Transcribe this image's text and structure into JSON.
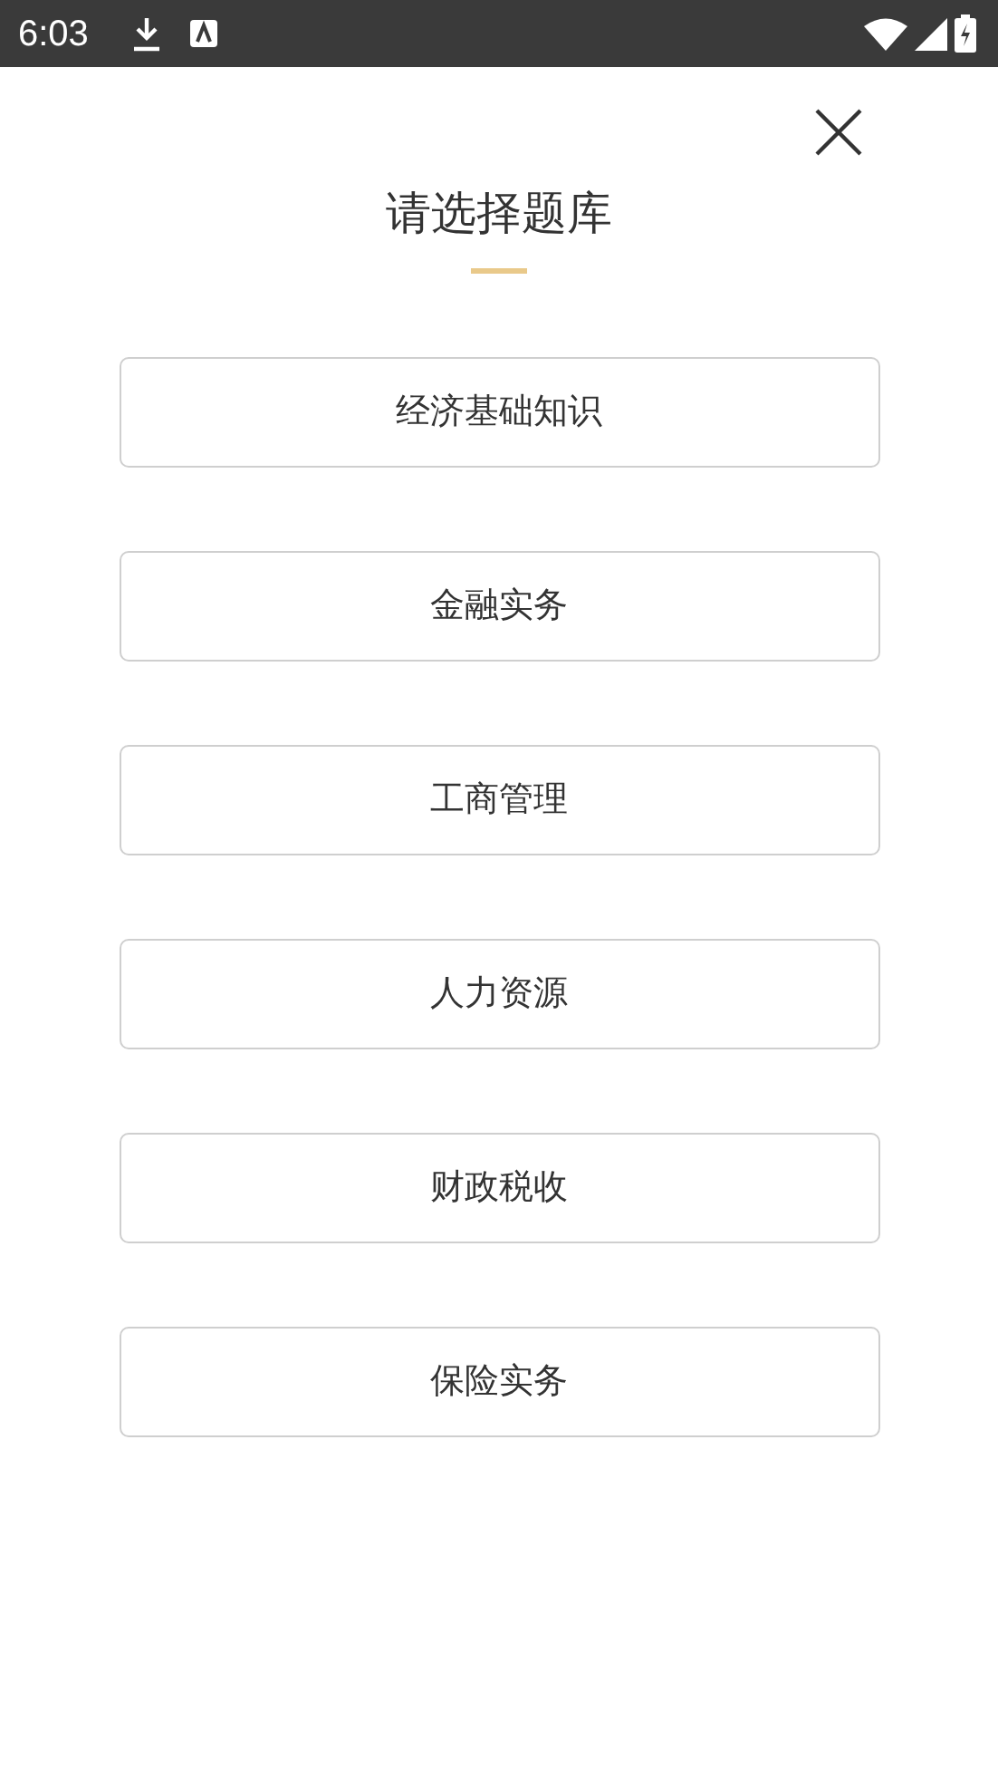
{
  "status_bar": {
    "time": "6:03"
  },
  "title": "请选择题库",
  "options": [
    {
      "label": "经济基础知识"
    },
    {
      "label": "金融实务"
    },
    {
      "label": "工商管理"
    },
    {
      "label": "人力资源"
    },
    {
      "label": "财政税收"
    },
    {
      "label": "保险实务"
    }
  ]
}
